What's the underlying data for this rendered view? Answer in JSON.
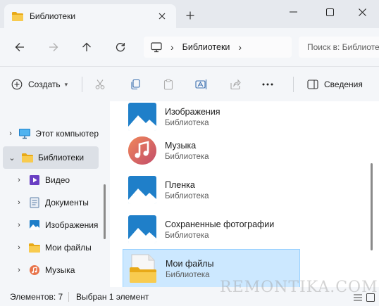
{
  "window": {
    "tab_title": "Библиотеки",
    "tab_icon": "folder-icon",
    "colors": {
      "accent": "#0067c0",
      "selection": "#cce8ff",
      "selection_border": "#99d1ff",
      "folder": "#f3c33f"
    }
  },
  "address": {
    "crumb": "Библиотеки",
    "search_placeholder": "Поиск в: Библиотеки"
  },
  "commands": {
    "create_label": "Создать",
    "details_label": "Сведения"
  },
  "nav_tree": [
    {
      "label": "Этот компьютер",
      "icon": "computer-icon",
      "level": 0,
      "expanded": false,
      "selected": false
    },
    {
      "label": "Библиотеки",
      "icon": "library-folder-icon",
      "level": 0,
      "expanded": true,
      "selected": true
    },
    {
      "label": "Видео",
      "icon": "video-icon",
      "level": 1,
      "expanded": false,
      "selected": false
    },
    {
      "label": "Документы",
      "icon": "documents-icon",
      "level": 1,
      "expanded": false,
      "selected": false
    },
    {
      "label": "Изображения",
      "icon": "pictures-icon",
      "level": 1,
      "expanded": false,
      "selected": false
    },
    {
      "label": "Мои файлы",
      "icon": "folder-icon",
      "level": 1,
      "expanded": false,
      "selected": false
    },
    {
      "label": "Музыка",
      "icon": "music-icon",
      "level": 1,
      "expanded": false,
      "selected": false
    }
  ],
  "items": [
    {
      "name": "Изображения",
      "type": "Библиотека",
      "icon": "pictures-library-icon"
    },
    {
      "name": "Музыка",
      "type": "Библиотека",
      "icon": "music-library-icon"
    },
    {
      "name": "Пленка",
      "type": "Библиотека",
      "icon": "camera-roll-library-icon"
    },
    {
      "name": "Сохраненные фотографии",
      "type": "Библиотека",
      "icon": "saved-pictures-library-icon"
    },
    {
      "name": "Мои файлы",
      "type": "Библиотека",
      "icon": "folder-library-icon",
      "selected": true
    }
  ],
  "status": {
    "count": "Элементов: 7",
    "selected": "Выбран 1 элемент"
  },
  "watermark": "REMONTIKA.COM"
}
